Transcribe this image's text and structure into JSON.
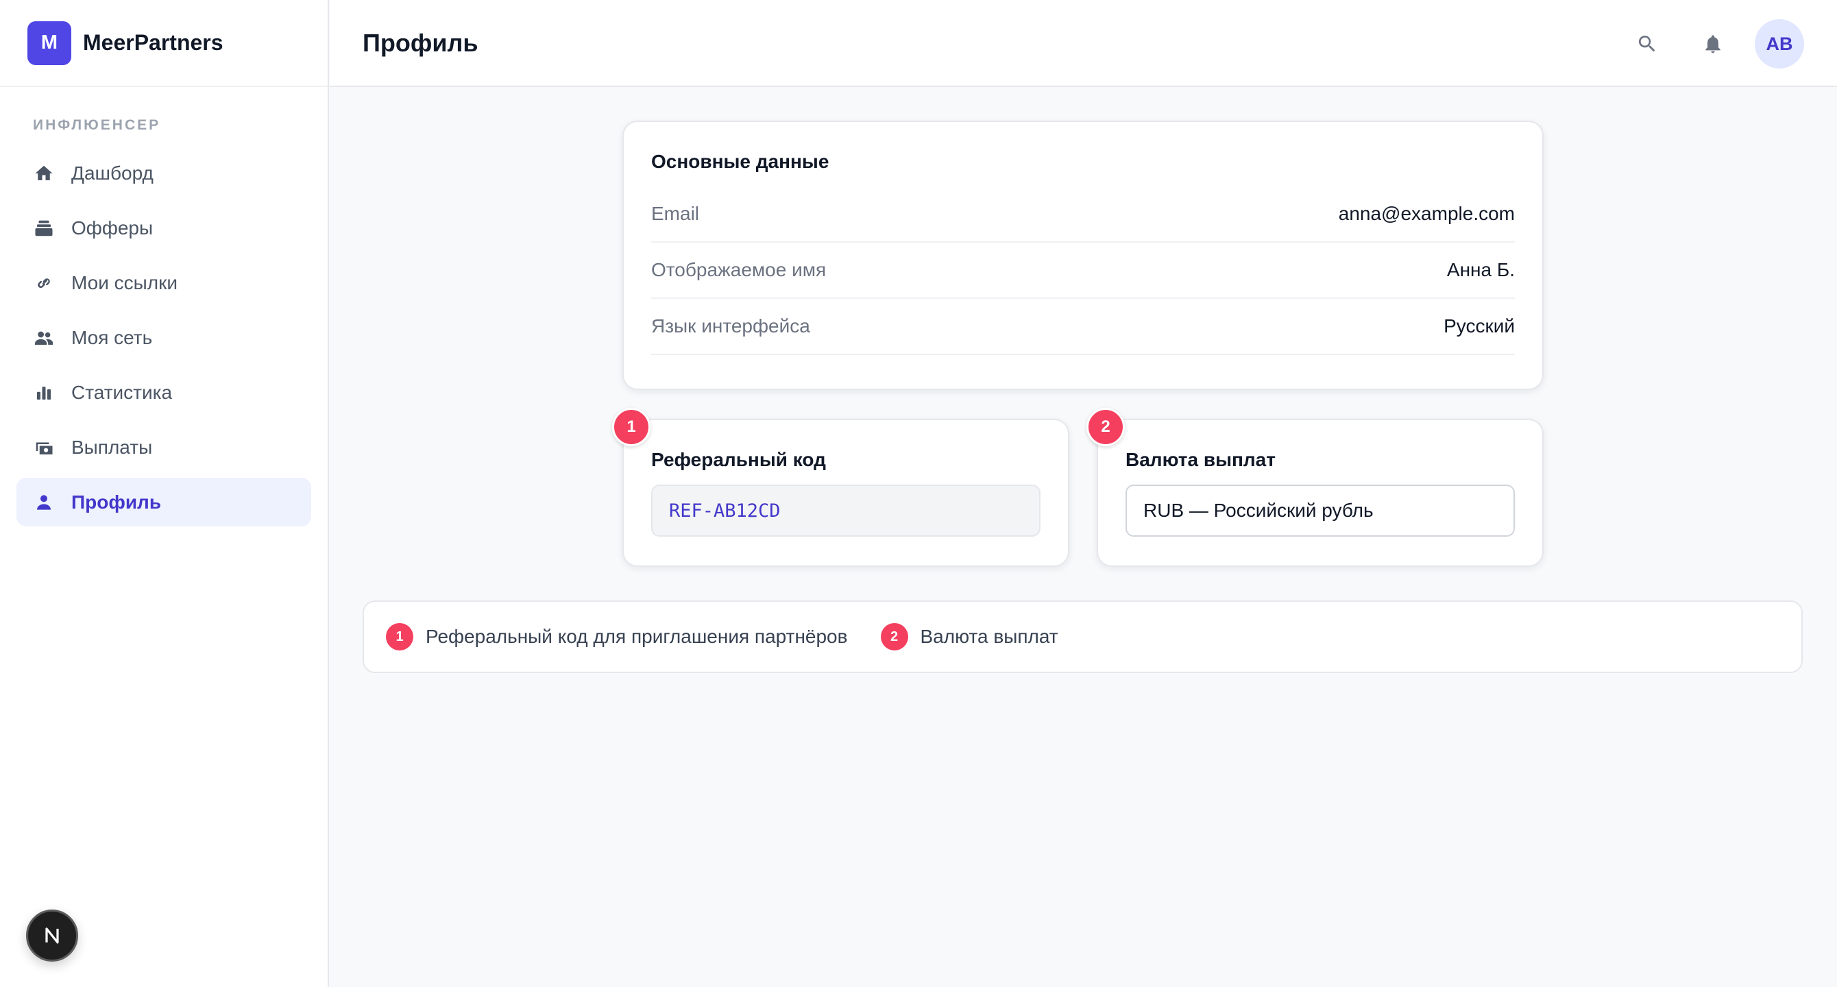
{
  "brand": {
    "logo_letter": "M",
    "name": "MeerPartners",
    "color": "#4f46e5"
  },
  "sidebar": {
    "section_label": "ИНФЛЮЕНСЕР",
    "items": [
      {
        "label": "Дашборд",
        "icon": "home-icon"
      },
      {
        "label": "Офферы",
        "icon": "stack-icon"
      },
      {
        "label": "Мои ссылки",
        "icon": "link-icon"
      },
      {
        "label": "Моя сеть",
        "icon": "people-icon"
      },
      {
        "label": "Статистика",
        "icon": "bar-chart-icon"
      },
      {
        "label": "Выплаты",
        "icon": "payments-icon"
      },
      {
        "label": "Профиль",
        "icon": "person-icon",
        "active": true
      }
    ]
  },
  "header": {
    "title": "Профиль",
    "search_icon": "search-icon",
    "bell_icon": "bell-icon",
    "avatar_initials": "AB"
  },
  "main_card": {
    "title": "Основные данные",
    "rows": [
      {
        "label": "Email",
        "value": "anna@example.com"
      },
      {
        "label": "Отображаемое имя",
        "value": "Анна Б."
      },
      {
        "label": "Язык интерфейса",
        "value": "Русский"
      }
    ]
  },
  "referral_card": {
    "marker": "1",
    "title": "Реферальный код",
    "code": "REF-AB12CD"
  },
  "currency_card": {
    "marker": "2",
    "title": "Валюта выплат",
    "selected": "RUB — Российский рубль"
  },
  "legend": {
    "items": [
      {
        "number": "1",
        "text": "Реферальный код для приглашения партнёров"
      },
      {
        "number": "2",
        "text": "Валюта выплат"
      }
    ]
  },
  "colors": {
    "accent": "#4338ca",
    "marker": "#f43f5e",
    "active_bg": "#eef2ff"
  },
  "next_badge": {
    "letter": "N"
  }
}
